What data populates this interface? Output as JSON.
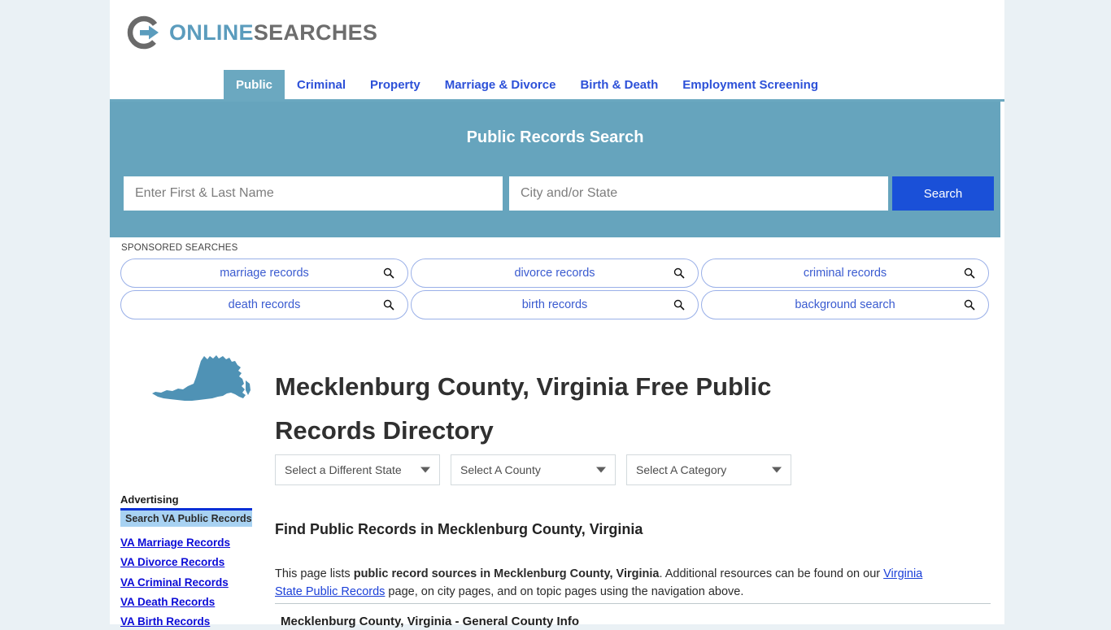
{
  "site": {
    "logo_primary": "ONLINE",
    "logo_secondary": "SEARCHES",
    "logo_icon": "circle-arrow-icon",
    "accent_teal": "#66a4bd",
    "accent_blue": "#2c50d8",
    "search_button_blue": "#1a50d8",
    "page_background": "#eaf1f5"
  },
  "nav": {
    "tabs": [
      {
        "label": "Public",
        "active": true
      },
      {
        "label": "Criminal",
        "active": false
      },
      {
        "label": "Property",
        "active": false
      },
      {
        "label": "Marriage & Divorce",
        "active": false
      },
      {
        "label": "Birth & Death",
        "active": false
      },
      {
        "label": "Employment Screening",
        "active": false
      }
    ]
  },
  "hero": {
    "title": "Public Records Search",
    "name_placeholder": "Enter First & Last Name",
    "name_value": "",
    "place_placeholder": "City and/or State",
    "place_value": "",
    "button_label": "Search"
  },
  "sponsored": {
    "label": "SPONSORED SEARCHES",
    "chips": [
      "marriage records",
      "divorce records",
      "criminal records",
      "death records",
      "birth records",
      "background search"
    ]
  },
  "title_block": {
    "state_icon": "virginia-state-outline-icon",
    "heading": "Mecklenburg County, Virginia Free Public Records Directory"
  },
  "selects": [
    {
      "name": "state",
      "value": "Select a Different State"
    },
    {
      "name": "county",
      "value": "Select A County"
    },
    {
      "name": "category",
      "value": "Select A Category"
    }
  ],
  "advertising": {
    "title": "Advertising",
    "box_label": "Search VA Public Records",
    "links": [
      "VA Marriage Records",
      "VA Divorce Records",
      "VA Criminal Records",
      "VA Death Records",
      "VA Birth Records"
    ]
  },
  "content": {
    "section_heading": "Find Public Records in Mecklenburg County, Virginia",
    "paragraph_lead": "This page lists ",
    "paragraph_bold": "public record sources in Mecklenburg County, Virginia",
    "paragraph_mid": ". Additional resources can be found on our ",
    "paragraph_link": "Virginia State Public Records",
    "paragraph_tail": " page, on city pages, and on topic pages using the navigation above.",
    "sub_heading": "Mecklenburg County, Virginia - General County Info"
  }
}
